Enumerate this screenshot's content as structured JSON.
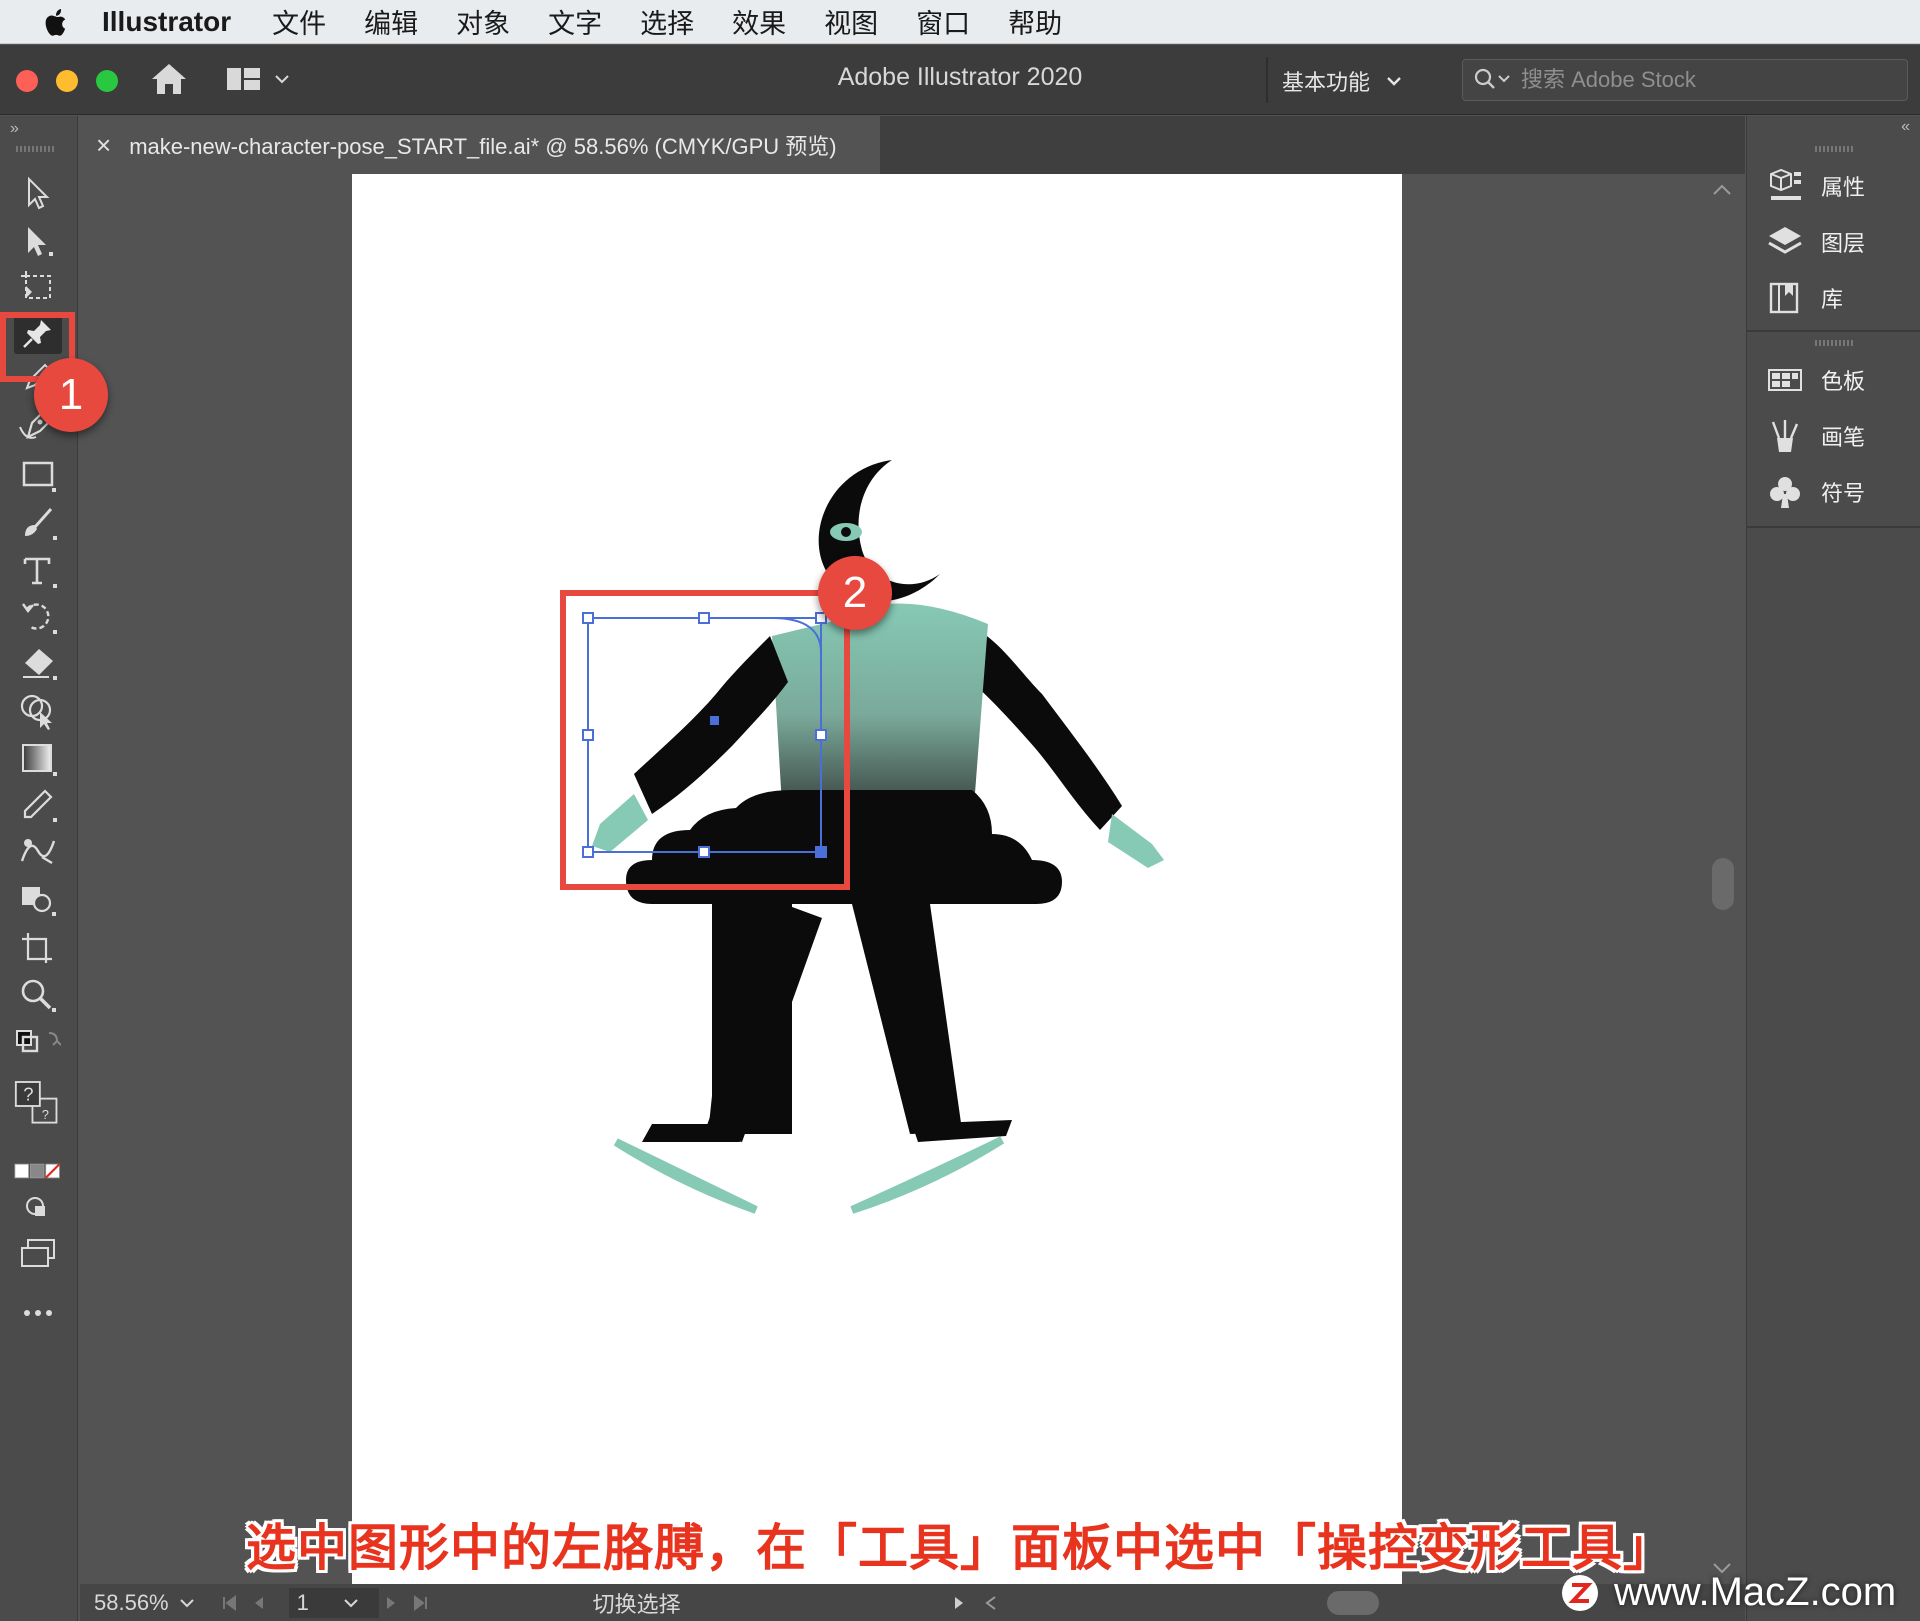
{
  "menubar": {
    "app_name": "Illustrator",
    "items": [
      "文件",
      "编辑",
      "对象",
      "文字",
      "选择",
      "效果",
      "视图",
      "窗口",
      "帮助"
    ]
  },
  "titlebar": {
    "title": "Adobe Illustrator 2020",
    "workspace": "基本功能",
    "search_placeholder": "搜索 Adobe Stock"
  },
  "document": {
    "tab_title": "make-new-character-pose_START_file.ai* @ 58.56% (CMYK/GPU 预览)",
    "close_glyph": "×"
  },
  "right_panels": {
    "group1": [
      {
        "label": "属性",
        "icon": "properties-icon"
      },
      {
        "label": "图层",
        "icon": "layers-icon"
      },
      {
        "label": "库",
        "icon": "libraries-icon"
      }
    ],
    "group2": [
      {
        "label": "色板",
        "icon": "swatches-icon"
      },
      {
        "label": "画笔",
        "icon": "brushes-icon"
      },
      {
        "label": "符号",
        "icon": "symbols-icon"
      }
    ]
  },
  "statusbar": {
    "zoom": "58.56%",
    "artboard_number": "1",
    "status_text": "切换选择"
  },
  "callouts": {
    "step1": "1",
    "step2": "2"
  },
  "caption": "选中图形中的左胳膊，在「工具」面板中选中「操控变形工具」",
  "watermark": "www.MacZ.com",
  "colors": {
    "highlight": "#e8493f",
    "selection_blue": "#4a6fd8",
    "character_teal": "#86c9b4",
    "character_black": "#0b0b0b"
  }
}
